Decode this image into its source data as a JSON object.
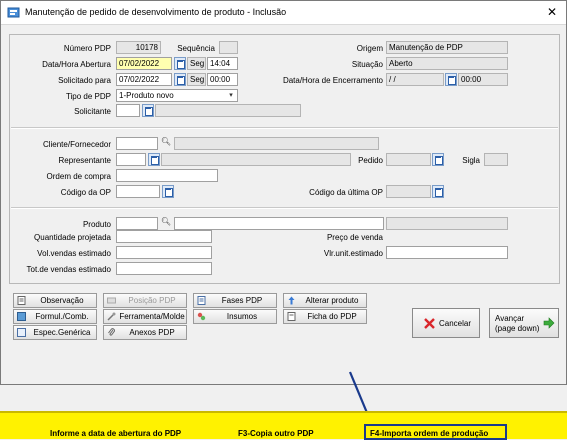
{
  "window": {
    "title": "Manutenção de pedido de desenvolvimento de produto - Inclusão",
    "close": "✕"
  },
  "header": {
    "numero_pdp_label": "Número PDP",
    "numero_pdp_value": "10178",
    "sequencia_label": "Sequência",
    "sequencia_value": "",
    "origem_label": "Origem",
    "origem_value": "Manutenção de PDP",
    "data_abertura_label": "Data/Hora Abertura",
    "data_abertura_value": "07/02/2022",
    "data_abertura_day": "Seg",
    "data_abertura_time": "14:04",
    "situacao_label": "Situação",
    "situacao_value": "Aberto",
    "solicitado_para_label": "Solicitado para",
    "solicitado_para_value": "07/02/2022",
    "solicitado_para_day": "Seg",
    "solicitado_para_time": "00:00",
    "encerramento_label": "Data/Hora de Encerramento",
    "encerramento_value": " / /",
    "encerramento_time": "00:00",
    "tipo_label": "Tipo de PDP",
    "tipo_value": "1-Produto novo",
    "solicitante_label": "Solicitante",
    "solicitante_value": ""
  },
  "client": {
    "cliente_label": "Cliente/Fornecedor",
    "representante_label": "Representante",
    "pedido_label": "Pedido",
    "sigla_label": "Sigla",
    "ordem_compra_label": "Ordem de compra",
    "codigo_op_label": "Código da OP",
    "codigo_ultima_op_label": "Código da última OP"
  },
  "product": {
    "produto_label": "Produto",
    "qtd_projetada_label": "Quantidade projetada",
    "preco_venda_label": "Preço de venda",
    "vol_vendas_label": "Vol.vendas estimado",
    "vlr_unit_label": "Vlr.unit.estimado",
    "tot_vendas_label": "Tot.de vendas estimado"
  },
  "buttons": {
    "observacao": "Observação",
    "posicao_pdp": "Posição PDP",
    "fases_pdp": "Fases PDP",
    "alterar_produto": "Alterar produto",
    "formul_comb": "Formul./Comb.",
    "ferramenta_molde": "Ferramenta/Molde",
    "insumos": "Insumos",
    "ficha_pdp": "Ficha do PDP",
    "espec_generica": "Espec.Genérica",
    "anexos_pdp": "Anexos PDP",
    "cancelar": "Cancelar",
    "avancar_line1": "Avançar",
    "avancar_line2": "(page down)"
  },
  "statusbar": {
    "hint": "Informe a data de abertura do PDP",
    "f3": "F3-Copia outro PDP",
    "f4": "F4-Importa ordem de produção"
  },
  "colors": {
    "statusbar_bg": "#fff200",
    "highlight_box": "#1a3a8c",
    "arrow": "#1a3a8c"
  }
}
